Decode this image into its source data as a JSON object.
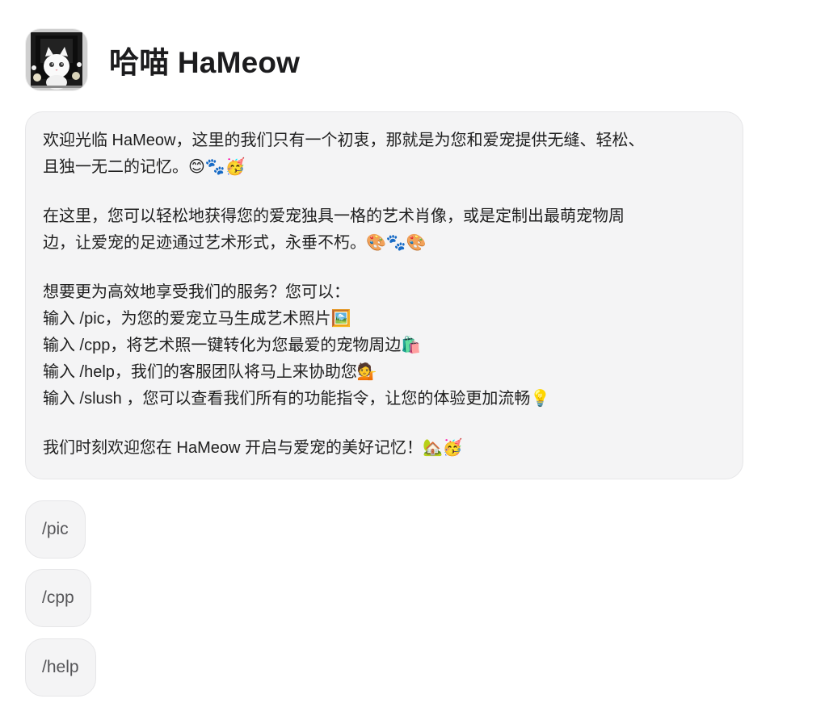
{
  "header": {
    "title": "哈喵 HaMeow",
    "avatar_icon": "white-cat-portrait-icon"
  },
  "message": {
    "paragraph_1": {
      "lines": [
        "欢迎光临 HaMeow，这里的我们只有一个初衷，那就是为您和爱宠提供无缝、轻松、",
        "且独一无二的记忆。😊🐾🥳"
      ]
    },
    "paragraph_2": {
      "lines": [
        "在这里，您可以轻松地获得您的爱宠独具一格的艺术肖像，或是定制出最萌宠物周",
        "边，让爱宠的足迹通过艺术形式，永垂不朽。🎨🐾🎨"
      ]
    },
    "paragraph_3": {
      "lines": [
        "想要更为高效地享受我们的服务？您可以：",
        "输入 /pic，为您的爱宠立马生成艺术照片🖼️",
        "输入 /cpp，将艺术照一键转化为您最爱的宠物周边🛍️",
        "输入 /help，我们的客服团队将马上来协助您💁",
        "输入 /slush ，您可以查看我们所有的功能指令，让您的体验更加流畅💡"
      ]
    },
    "paragraph_4": {
      "lines": [
        "我们时刻欢迎您在 HaMeow 开启与爱宠的美好记忆！🏡🥳"
      ]
    }
  },
  "commands": [
    {
      "label": "/pic"
    },
    {
      "label": "/cpp"
    },
    {
      "label": "/help"
    }
  ],
  "colors": {
    "bubble_bg": "#f4f4f5",
    "bubble_border": "#e6e6e8",
    "text": "#1f1f1f",
    "command_text": "#555558"
  }
}
